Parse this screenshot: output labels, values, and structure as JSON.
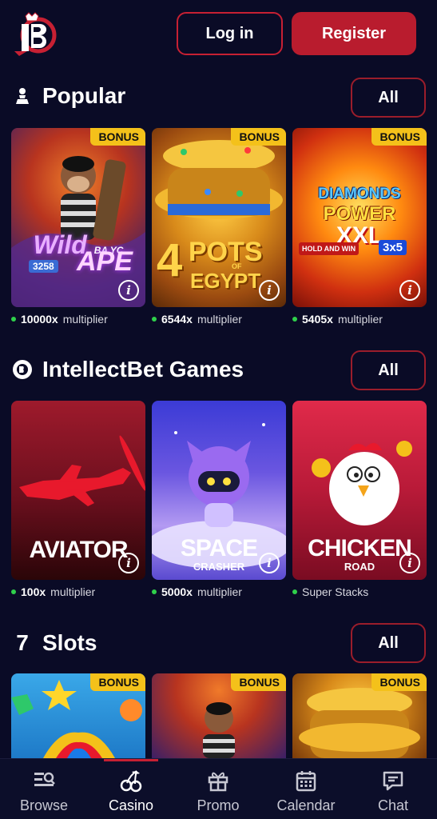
{
  "header": {
    "logo_text": "IB",
    "login_label": "Log in",
    "register_label": "Register"
  },
  "sections": {
    "popular": {
      "title": "Popular",
      "all_label": "All",
      "icon": "chess-pawn-icon",
      "games": [
        {
          "name": "Wild Ape",
          "badge": "BONUS",
          "multiplier": "10000x",
          "suffix": "multiplier"
        },
        {
          "name": "4 Pots of Egypt",
          "badge": "BONUS",
          "multiplier": "6544x",
          "suffix": "multiplier"
        },
        {
          "name": "Diamonds Power XXL",
          "badge": "BONUS",
          "multiplier": "5405x",
          "suffix": "multiplier"
        }
      ]
    },
    "intellectbet": {
      "title": "IntellectBet Games",
      "all_label": "All",
      "icon": "intellectbet-logo-icon",
      "games": [
        {
          "name": "AVIATOR",
          "multiplier": "100x",
          "suffix": "multiplier"
        },
        {
          "name": "SPACE",
          "sub": "CRASHER",
          "multiplier": "5000x",
          "suffix": "multiplier"
        },
        {
          "name": "CHICKEN",
          "sub": "ROAD",
          "multiplier": "",
          "suffix": "Super Stacks"
        }
      ]
    },
    "slots": {
      "title": "Slots",
      "all_label": "All",
      "icon": "seven-icon",
      "games": [
        {
          "badge": "BONUS"
        },
        {
          "badge": "BONUS"
        },
        {
          "badge": "BONUS"
        }
      ]
    }
  },
  "game_art": {
    "wild_ape_line1": "Wild",
    "wild_ape_line2": "APE",
    "wild_ape_tag": "BA YC",
    "wild_ape_num": "3258",
    "pots_num": "4",
    "pots_line1": "POTS",
    "pots_of": "OF",
    "pots_line2": "EGYPT",
    "diamonds_line1": "DIAMONDS",
    "diamonds_line2": "POWER",
    "diamonds_line3": "XXL",
    "diamonds_sub": "HOLD AND WIN",
    "diamonds_grid": "3x5"
  },
  "nav": {
    "items": [
      {
        "label": "Browse",
        "icon": "browse-icon"
      },
      {
        "label": "Casino",
        "icon": "cherries-icon"
      },
      {
        "label": "Promo",
        "icon": "gift-icon"
      },
      {
        "label": "Calendar",
        "icon": "calendar-icon"
      },
      {
        "label": "Chat",
        "icon": "chat-icon"
      }
    ],
    "active_index": 1
  },
  "colors": {
    "background": "#0a0b26",
    "accent": "#c72033",
    "badge": "#f4c11a",
    "online_dot": "#2fd04b"
  }
}
